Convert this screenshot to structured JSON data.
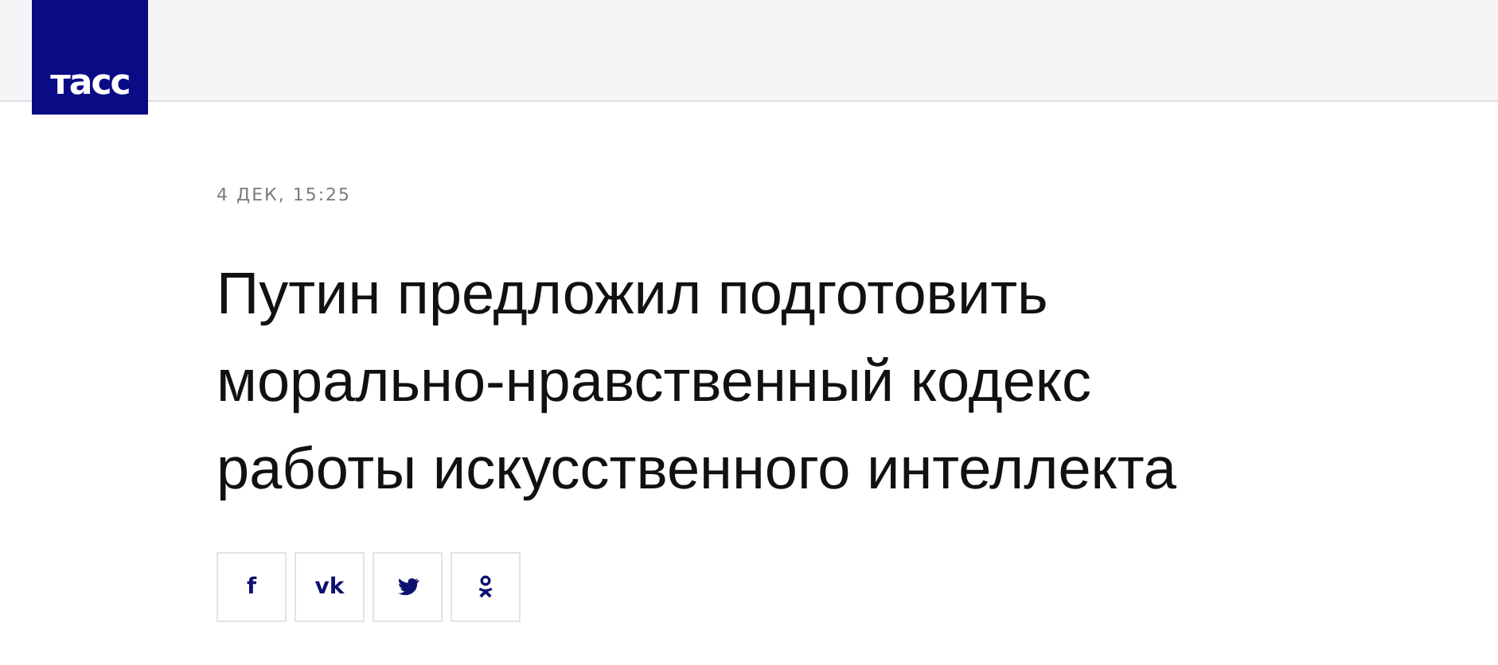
{
  "header": {
    "logo": "тасс"
  },
  "article": {
    "date": "4 ДЕК, 15:25",
    "headline": "Путин предложил подготовить морально-нравственный кодекс работы искусственного интеллекта",
    "share_buttons": [
      {
        "kind": "letter",
        "label": "f"
      },
      {
        "kind": "letter",
        "label": "vk"
      },
      {
        "kind": "bird"
      },
      {
        "kind": "figure"
      }
    ]
  }
}
